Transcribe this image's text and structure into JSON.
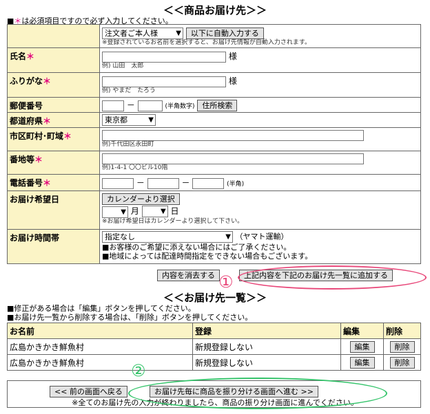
{
  "title": "＜＜商品お届け先＞＞",
  "required_note": {
    "prefix": "■",
    "mark": "＊",
    "text": "は必須項目ですので必ず入力してください。"
  },
  "autofill": {
    "select_value": "注文者ご本人様",
    "button": "以下に自動入力する",
    "note": "※登録されているお名前を選択すると、お届け先情報が自動入力されます。"
  },
  "fields": {
    "name": {
      "label": "氏名",
      "suffix": "様",
      "hint": "例) 山田　太郎"
    },
    "kana": {
      "label": "ふりがな",
      "suffix": "様",
      "hint": "例) やまだ　たろう"
    },
    "zip": {
      "label": "郵便番号",
      "dash": "－",
      "hint": "(半角数字)",
      "button": "住所検索"
    },
    "pref": {
      "label": "都道府県",
      "value": "東京都"
    },
    "city": {
      "label": "市区町村･町域",
      "hint": "例)千代田区永田町"
    },
    "addr": {
      "label": "番地等",
      "hint": "例)1-4-1 〇〇ビル10階"
    },
    "tel": {
      "label": "電話番号",
      "dash": "－",
      "hint": "(半角)"
    },
    "date": {
      "label": "お届け希望日",
      "button": "カレンダーより選択",
      "month": "月",
      "day": "日",
      "note": "※お届け希望日はカレンダーより選択して下さい。"
    },
    "time": {
      "label": "お届け時間帯",
      "value": "指定なし",
      "carrier": "（ヤマト運輸）",
      "note1": "■お客様のご希望に添えない場合にはご了承ください。",
      "note2": "■地域によっては配達時間指定をできない場合もございます。"
    }
  },
  "actions": {
    "clear": "内容を消去する",
    "add": "上記内容を下記のお届け先一覧に追加する"
  },
  "list_title": "＜＜お届け先一覧＞＞",
  "list_notes": [
    "■修正がある場合は「編集」ボタンを押してください。",
    "■お届け先一覧から削除する場合は、「削除」ボタンを押してください。"
  ],
  "list": {
    "headers": [
      "お名前",
      "登録",
      "編集",
      "削除"
    ],
    "rows": [
      {
        "name": "広島かきかき鮮魚村",
        "status": "新規登録しない",
        "edit": "編集",
        "del": "削除"
      },
      {
        "name": "広島かきかき鮮魚村",
        "status": "新規登録しない",
        "edit": "編集",
        "del": "削除"
      }
    ]
  },
  "footer": {
    "back": "<< 前の画面へ戻る",
    "next": "お届け先毎に商品を振り分ける画面へ進む >>",
    "note": "※全てのお届け先の入力が終わりましたら、商品の振り分け画面に進んでください。"
  },
  "annotations": {
    "one": "①",
    "two": "②",
    "red_color": "#e8487a",
    "green_color": "#35c46b"
  }
}
